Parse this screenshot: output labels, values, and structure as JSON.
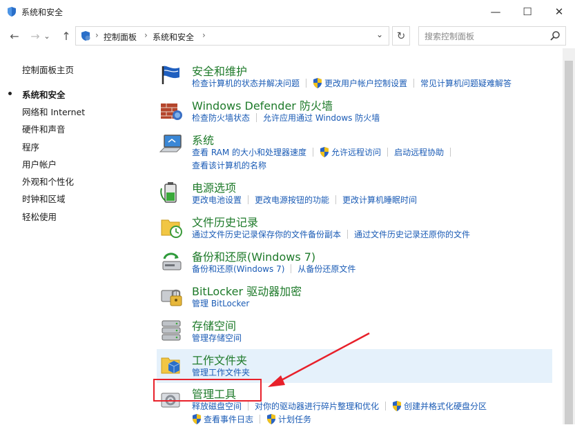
{
  "window": {
    "title": "系统和安全",
    "minimize": "—",
    "maximize": "☐",
    "close": "✕"
  },
  "nav": {
    "back": "←",
    "forward": "→",
    "history": "⌄",
    "up": "↑",
    "breadcrumbs": [
      "控制面板",
      "系统和安全"
    ],
    "crumb_sep": "›",
    "addr_dropdown": "⌄",
    "refresh": "↻",
    "search_placeholder": "搜索控制面板"
  },
  "sidebar": {
    "items": [
      {
        "label": "控制面板主页"
      },
      {
        "label": "系统和安全"
      },
      {
        "label": "网络和 Internet"
      },
      {
        "label": "硬件和声音"
      },
      {
        "label": "程序"
      },
      {
        "label": "用户帐户"
      },
      {
        "label": "外观和个性化"
      },
      {
        "label": "时钟和区域"
      },
      {
        "label": "轻松使用"
      }
    ]
  },
  "categories": [
    {
      "title": "安全和维护",
      "icon": "flag-icon",
      "links": [
        "检查计算机的状态并解决问题",
        "更改用户帐户控制设置",
        "常见计算机问题疑难解答"
      ]
    },
    {
      "title": "Windows Defender 防火墙",
      "icon": "firewall-icon",
      "links": [
        "检查防火墙状态",
        "允许应用通过 Windows 防火墙"
      ]
    },
    {
      "title": "系统",
      "icon": "computer-icon",
      "links": [
        "查看 RAM 的大小和处理器速度",
        "允许远程访问",
        "启动远程协助",
        "查看该计算机的名称"
      ]
    },
    {
      "title": "电源选项",
      "icon": "power-icon",
      "links": [
        "更改电池设置",
        "更改电源按钮的功能",
        "更改计算机睡眠时间"
      ]
    },
    {
      "title": "文件历史记录",
      "icon": "file-history-icon",
      "links": [
        "通过文件历史记录保存你的文件备份副本",
        "通过文件历史记录还原你的文件"
      ]
    },
    {
      "title": "备份和还原(Windows 7)",
      "icon": "backup-icon",
      "links": [
        "备份和还原(Windows 7)",
        "从备份还原文件"
      ]
    },
    {
      "title": "BitLocker 驱动器加密",
      "icon": "bitlocker-icon",
      "links": [
        "管理 BitLocker"
      ]
    },
    {
      "title": "存储空间",
      "icon": "storage-icon",
      "links": [
        "管理存储空间"
      ]
    },
    {
      "title": "工作文件夹",
      "icon": "work-folders-icon",
      "links": [
        "管理工作文件夹"
      ]
    },
    {
      "title": "管理工具",
      "icon": "admin-tools-icon",
      "links": [
        "释放磁盘空间",
        "对你的驱动器进行碎片整理和优化",
        "创建并格式化硬盘分区",
        "查看事件日志",
        "计划任务"
      ]
    }
  ],
  "colors": {
    "category_title": "#1e7a2a",
    "link": "#1a5bb5",
    "highlight": "#e5f1fb",
    "annotation_red": "#e8202a"
  }
}
